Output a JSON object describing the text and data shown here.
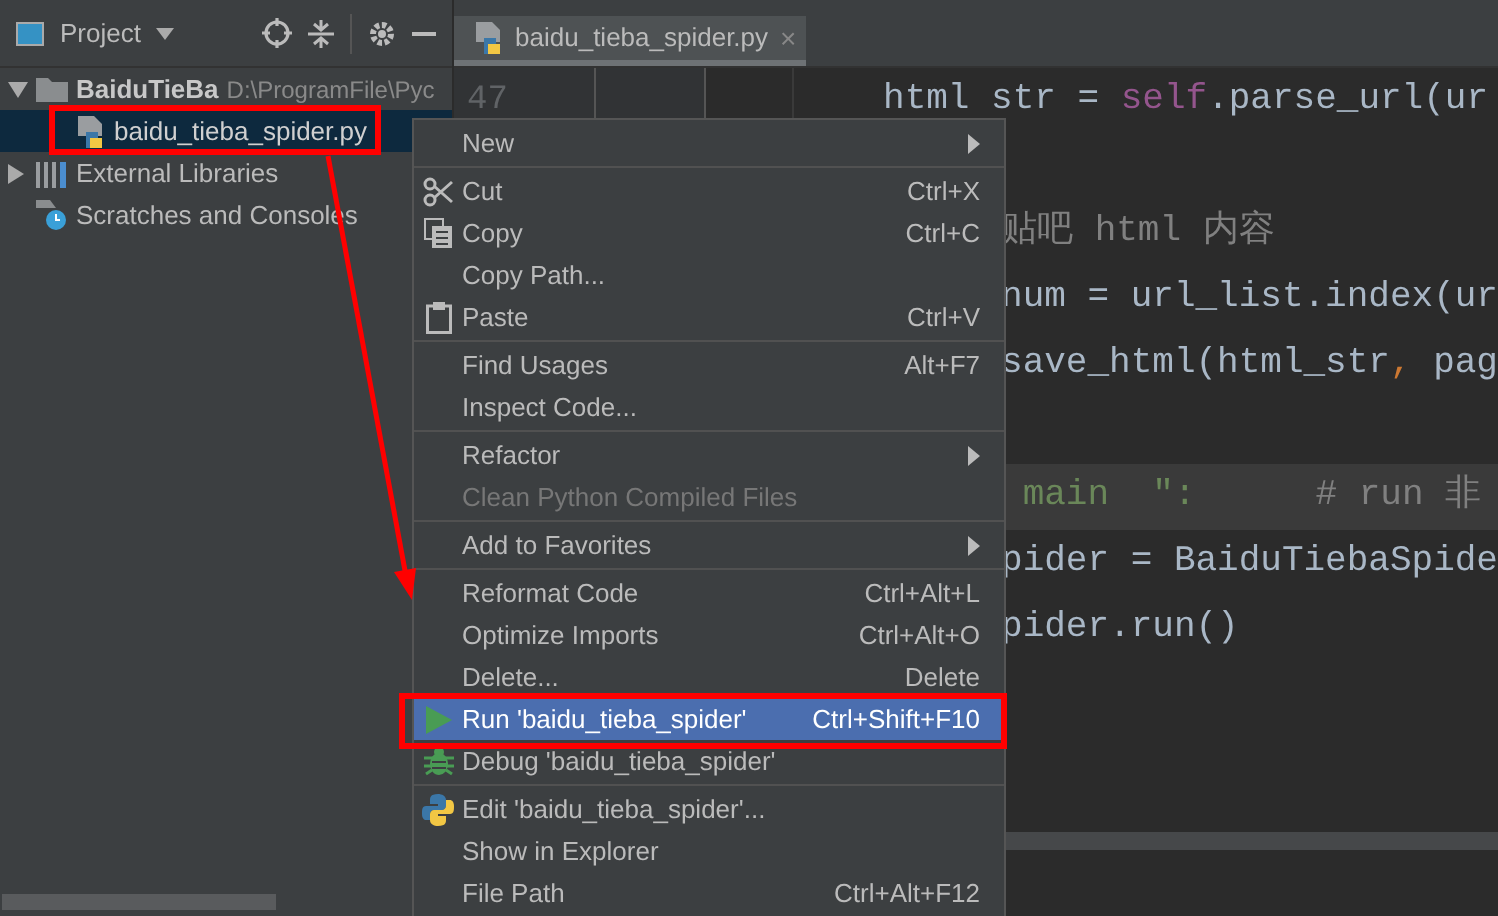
{
  "project_panel": {
    "title": "Project",
    "tree": [
      {
        "label": "BaiduTieBa",
        "path": "D:\\ProgramFile\\Pyc",
        "kind": "folder",
        "expanded": true,
        "selected": false,
        "children": [
          {
            "label": "baidu_tieba_spider.py",
            "kind": "file",
            "selected": true
          }
        ]
      },
      {
        "label": "External Libraries",
        "kind": "libraries",
        "expanded": false,
        "selected": false
      },
      {
        "label": "Scratches and Consoles",
        "kind": "scratches",
        "selected": false
      }
    ]
  },
  "editor": {
    "tab": {
      "label": "baidu_tieba_spider.py",
      "close": "×"
    },
    "line_numbers": [
      "47"
    ],
    "lines": [
      {
        "covered": false,
        "current": false,
        "tokens": [
          {
            "text": "html str = ",
            "kind": "plain"
          },
          {
            "text": "self",
            "kind": "self"
          },
          {
            "text": ".parse_url(ur",
            "kind": "plain"
          }
        ]
      },
      {
        "covered": false,
        "current": false
      },
      {
        "covered": true,
        "current": false,
        "tokens": [
          {
            "text": "贴吧 html 内容",
            "kind": "comment"
          }
        ]
      },
      {
        "covered": true,
        "current": false,
        "tokens": [
          {
            "text": "num = url_list.index(ur",
            "kind": "plain"
          }
        ]
      },
      {
        "covered": true,
        "current": false,
        "tokens": [
          {
            "text": "save_html(html_str",
            "kind": "plain"
          },
          {
            "text": ",",
            "kind": "punct"
          },
          {
            "text": " pag",
            "kind": "plain"
          }
        ]
      },
      {
        "covered": false,
        "current": false
      },
      {
        "covered": true,
        "current": true,
        "tokens": [
          {
            "text": " main  \":",
            "kind": "string"
          },
          {
            "text": "# run 非",
            "kind": "comment"
          }
        ]
      },
      {
        "covered": true,
        "current": false,
        "tokens": [
          {
            "text": "pider = BaiduTiebaSpide",
            "kind": "plain"
          }
        ]
      },
      {
        "covered": true,
        "current": false,
        "tokens": [
          {
            "text": "pider.run()",
            "kind": "plain"
          }
        ]
      }
    ]
  },
  "context_menu": {
    "groups": [
      [
        {
          "label": "New",
          "submenu": true,
          "selected": false,
          "disabled": false
        }
      ],
      [
        {
          "label": "Cut",
          "shortcut": "Ctrl+X",
          "selected": false,
          "disabled": false
        },
        {
          "label": "Copy",
          "shortcut": "Ctrl+C",
          "selected": false,
          "disabled": false
        },
        {
          "label": "Copy Path...",
          "selected": false,
          "disabled": false
        },
        {
          "label": "Paste",
          "shortcut": "Ctrl+V",
          "selected": false,
          "disabled": false
        }
      ],
      [
        {
          "label": "Find Usages",
          "shortcut": "Alt+F7",
          "selected": false,
          "disabled": false
        },
        {
          "label": "Inspect Code...",
          "selected": false,
          "disabled": false
        }
      ],
      [
        {
          "label": "Refactor",
          "submenu": true,
          "selected": false,
          "disabled": false
        },
        {
          "label": "Clean Python Compiled Files",
          "selected": false,
          "disabled": true
        }
      ],
      [
        {
          "label": "Add to Favorites",
          "submenu": true,
          "selected": false,
          "disabled": false
        }
      ],
      [
        {
          "label": "Reformat Code",
          "shortcut": "Ctrl+Alt+L",
          "selected": false,
          "disabled": false
        },
        {
          "label": "Optimize Imports",
          "shortcut": "Ctrl+Alt+O",
          "selected": false,
          "disabled": false
        },
        {
          "label": "Delete...",
          "shortcut": "Delete",
          "selected": false,
          "disabled": false
        },
        {
          "label": "Run 'baidu_tieba_spider'",
          "shortcut": "Ctrl+Shift+F10",
          "selected": true,
          "disabled": false
        },
        {
          "label": "Debug 'baidu_tieba_spider'",
          "selected": false,
          "disabled": false
        }
      ],
      [
        {
          "label": "Edit 'baidu_tieba_spider'...",
          "selected": false,
          "disabled": false
        },
        {
          "label": "Show in Explorer",
          "selected": false,
          "disabled": false
        },
        {
          "label": "File Path",
          "shortcut": "Ctrl+Alt+F12",
          "selected": false,
          "disabled": false
        }
      ]
    ]
  }
}
